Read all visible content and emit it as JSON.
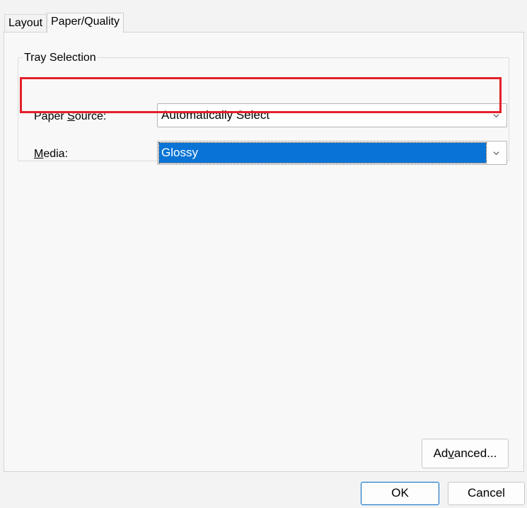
{
  "tabs": [
    {
      "label": "Layout",
      "active": false
    },
    {
      "label": "Paper/Quality",
      "active": true
    }
  ],
  "tray_selection": {
    "title": "Tray Selection",
    "paper_source": {
      "label_pre": "Paper ",
      "label_mnemonic": "S",
      "label_post": "ource:",
      "value": "Automatically Select"
    },
    "media": {
      "label_pre": "",
      "label_mnemonic": "M",
      "label_post": "edia:",
      "value": "Glossy"
    }
  },
  "buttons": {
    "advanced_pre": "Ad",
    "advanced_mnemonic": "v",
    "advanced_post": "anced...",
    "ok": "OK",
    "cancel": "Cancel"
  },
  "icons": {
    "dropdown": "chevron-down-icon"
  },
  "colors": {
    "selection": "#0a74d6",
    "highlight_box": "#e3202a",
    "default_button_border": "#0067c0"
  }
}
